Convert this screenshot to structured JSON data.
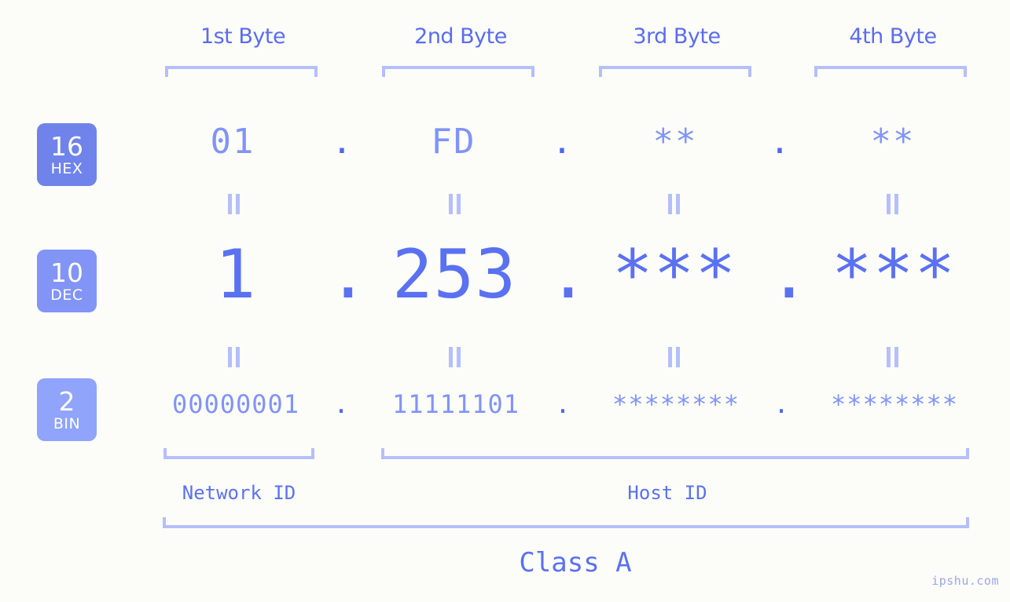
{
  "meta": {
    "background_color": "#fcfdf8",
    "accent_color": "#5a71f2",
    "light_accent_color": "#b4bffb",
    "mid_accent_color": "#8094f7"
  },
  "header": {
    "bytes": [
      {
        "label": "1st Byte"
      },
      {
        "label": "2nd Byte"
      },
      {
        "label": "3rd Byte"
      },
      {
        "label": "4th Byte"
      }
    ]
  },
  "radix_badges": [
    {
      "number": "16",
      "name": "HEX",
      "color": "#7083ea"
    },
    {
      "number": "10",
      "name": "DEC",
      "color": "#8294f5"
    },
    {
      "number": "2",
      "name": "BIN",
      "color": "#8fa4fa"
    }
  ],
  "rows": {
    "hex": {
      "values": [
        "01",
        "FD",
        "**",
        "**"
      ],
      "separators": [
        ".",
        ".",
        "."
      ]
    },
    "dec": {
      "values": [
        "1",
        "253",
        "***",
        "***"
      ],
      "separators": [
        ".",
        ".",
        "."
      ]
    },
    "bin": {
      "values": [
        "00000001",
        "11111101",
        "********",
        "********"
      ],
      "separators": [
        ".",
        ".",
        "."
      ]
    }
  },
  "equals_markers": {
    "symbol": "||",
    "count_per_row": 4
  },
  "footer": {
    "regions": [
      {
        "label": "Network ID"
      },
      {
        "label": "Host ID"
      }
    ],
    "class_label": "Class A"
  },
  "watermark": {
    "text": "ipshu.com"
  }
}
